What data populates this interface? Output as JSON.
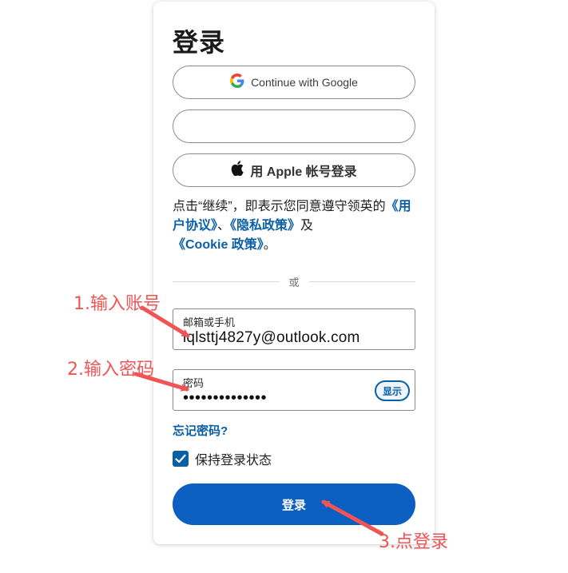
{
  "login": {
    "title": "登录",
    "google_label": "Continue with Google",
    "apple_label": "用 Apple 帐号登录",
    "terms": {
      "prefix": "点击“继续”，即表示您同意遵守领英的",
      "user_agreement": "《用户协议》",
      "sep": "、",
      "privacy_policy": "《隐私政策》",
      "and": "及",
      "cookie_policy": "《Cookie 政策》",
      "end": "。"
    },
    "divider_text": "或",
    "email": {
      "label": "邮箱或手机",
      "value": "iqlsttj4827y@outlook.com"
    },
    "password": {
      "label": "密码",
      "value": "••••••••••••••",
      "show_label": "显示"
    },
    "forgot_label": "忘记密码?",
    "keep_label": "保持登录状态",
    "keep_checked": true,
    "submit_label": "登录"
  },
  "annotations": {
    "step1": "1.输入账号",
    "step2": "2.输入密码",
    "step3": "3.点登录"
  },
  "colors": {
    "accent": "#0b5fc0",
    "link": "#0b5fa5",
    "annotation": "#f05454"
  },
  "icons": {
    "google": "google-logo-icon",
    "apple": "apple-logo-icon",
    "check": "check-icon"
  }
}
